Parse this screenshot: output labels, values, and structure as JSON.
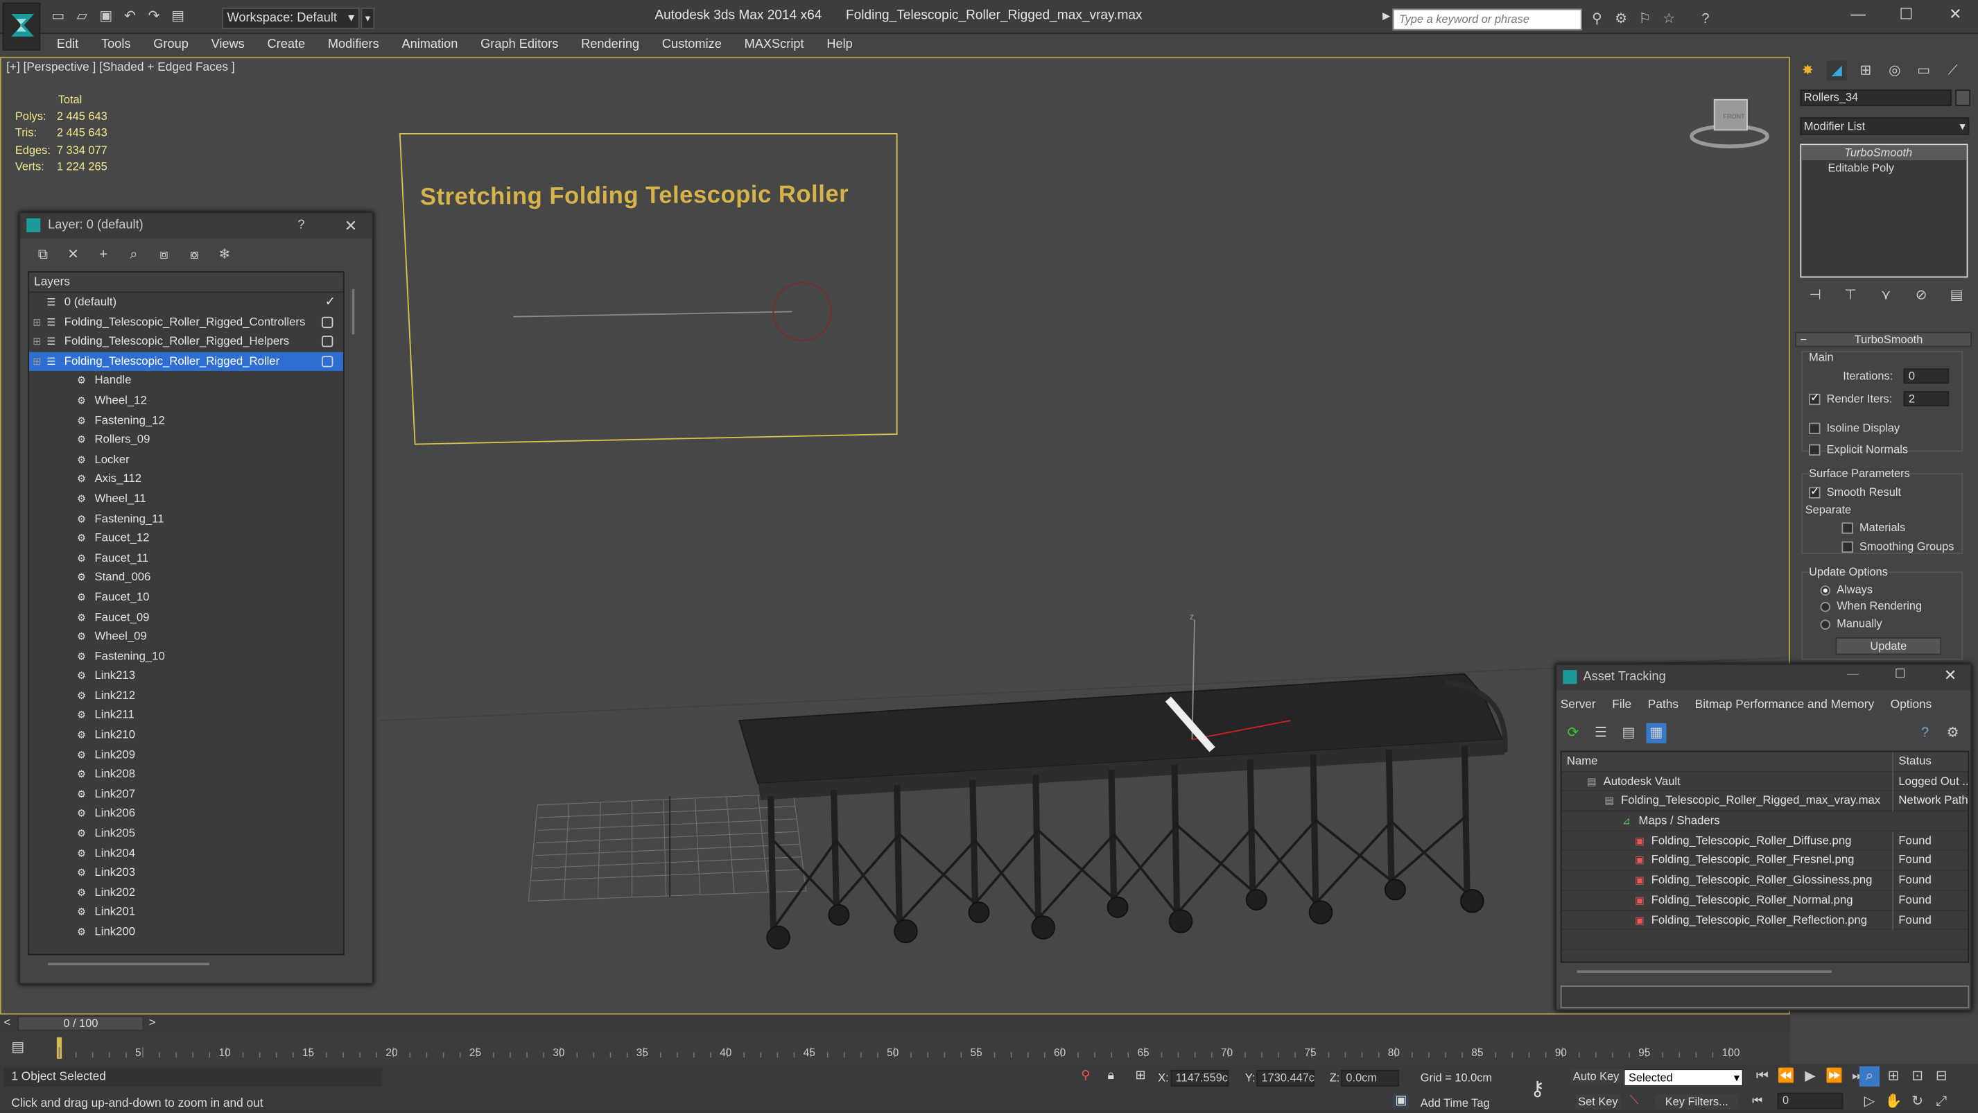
{
  "titlebar": {
    "app_title": "Autodesk 3ds Max  2014 x64",
    "file_name": "Folding_Telescopic_Roller_Rigged_max_vray.max",
    "workspace": "Workspace: Default",
    "search_placeholder": "Type a keyword or phrase"
  },
  "menu": [
    "Edit",
    "Tools",
    "Group",
    "Views",
    "Create",
    "Modifiers",
    "Animation",
    "Graph Editors",
    "Rendering",
    "Customize",
    "MAXScript",
    "Help"
  ],
  "viewport": {
    "label": "[+] [Perspective ] [Shaded + Edged Faces ]",
    "stats_header": "Total",
    "stats": [
      {
        "key": "Polys:",
        "value": "2 445 643"
      },
      {
        "key": "Tris:",
        "value": "2 445 643"
      },
      {
        "key": "Edges:",
        "value": "7 334 077"
      },
      {
        "key": "Verts:",
        "value": "1 224 265"
      }
    ],
    "banner_text": "Stretching Folding Telescopic Roller",
    "viewcube_label": "FRONT"
  },
  "layer_dialog": {
    "title": "Layer: 0 (default)",
    "help": "?",
    "column": "Layers",
    "layers": [
      {
        "name": "0 (default)",
        "level": 0,
        "checked": true
      },
      {
        "name": "Folding_Telescopic_Roller_Rigged_Controllers",
        "level": 0,
        "box": true
      },
      {
        "name": "Folding_Telescopic_Roller_Rigged_Helpers",
        "level": 0,
        "box": true
      },
      {
        "name": "Folding_Telescopic_Roller_Rigged_Roller",
        "level": 0,
        "box": true,
        "selected": true
      },
      {
        "name": "Handle",
        "level": 1
      },
      {
        "name": "Wheel_12",
        "level": 1
      },
      {
        "name": "Fastening_12",
        "level": 1
      },
      {
        "name": "Rollers_09",
        "level": 1
      },
      {
        "name": "Locker",
        "level": 1
      },
      {
        "name": "Axis_112",
        "level": 1
      },
      {
        "name": "Wheel_11",
        "level": 1
      },
      {
        "name": "Fastening_11",
        "level": 1
      },
      {
        "name": "Faucet_12",
        "level": 1
      },
      {
        "name": "Faucet_11",
        "level": 1
      },
      {
        "name": "Stand_006",
        "level": 1
      },
      {
        "name": "Faucet_10",
        "level": 1
      },
      {
        "name": "Faucet_09",
        "level": 1
      },
      {
        "name": "Wheel_09",
        "level": 1
      },
      {
        "name": "Fastening_10",
        "level": 1
      },
      {
        "name": "Link213",
        "level": 1
      },
      {
        "name": "Link212",
        "level": 1
      },
      {
        "name": "Link211",
        "level": 1
      },
      {
        "name": "Link210",
        "level": 1
      },
      {
        "name": "Link209",
        "level": 1
      },
      {
        "name": "Link208",
        "level": 1
      },
      {
        "name": "Link207",
        "level": 1
      },
      {
        "name": "Link206",
        "level": 1
      },
      {
        "name": "Link205",
        "level": 1
      },
      {
        "name": "Link204",
        "level": 1
      },
      {
        "name": "Link203",
        "level": 1
      },
      {
        "name": "Link202",
        "level": 1
      },
      {
        "name": "Link201",
        "level": 1
      },
      {
        "name": "Link200",
        "level": 1
      }
    ]
  },
  "command_panel": {
    "object_name": "Rollers_34",
    "modifier_list": "Modifier List",
    "stack": [
      "TurboSmooth",
      "Editable Poly"
    ],
    "rollout_title": "TurboSmooth",
    "main_group": "Main",
    "iterations_label": "Iterations:",
    "iterations_value": "0",
    "render_iters_label": "Render Iters:",
    "render_iters_value": "2",
    "isoline_label": "Isoline Display",
    "explicit_normals_label": "Explicit Normals",
    "surface_group": "Surface Parameters",
    "smooth_result_label": "Smooth Result",
    "separate_label": "Separate",
    "materials_label": "Materials",
    "smoothing_groups_label": "Smoothing Groups",
    "update_group": "Update Options",
    "always_label": "Always",
    "when_rendering_label": "When Rendering",
    "manually_label": "Manually",
    "update_button": "Update"
  },
  "asset_tracking": {
    "title": "Asset Tracking",
    "menu": [
      "Server",
      "File",
      "Paths",
      "Bitmap Performance and Memory",
      "Options"
    ],
    "col_name": "Name",
    "col_status": "Status",
    "rows": [
      {
        "name": "Autodesk Vault",
        "status": "Logged Out ...",
        "level": 1
      },
      {
        "name": "Folding_Telescopic_Roller_Rigged_max_vray.max",
        "status": "Network Path",
        "level": 2
      },
      {
        "name": "Maps / Shaders",
        "status": "",
        "level": 3
      },
      {
        "name": "Folding_Telescopic_Roller_Diffuse.png",
        "status": "Found",
        "level": 4
      },
      {
        "name": "Folding_Telescopic_Roller_Fresnel.png",
        "status": "Found",
        "level": 4
      },
      {
        "name": "Folding_Telescopic_Roller_Glossiness.png",
        "status": "Found",
        "level": 4
      },
      {
        "name": "Folding_Telescopic_Roller_Normal.png",
        "status": "Found",
        "level": 4
      },
      {
        "name": "Folding_Telescopic_Roller_Reflection.png",
        "status": "Found",
        "level": 4
      }
    ]
  },
  "timeline": {
    "frame_display": "0 / 100",
    "ticks": [
      "5",
      "10",
      "15",
      "20",
      "25",
      "30",
      "35",
      "40",
      "45",
      "50",
      "55",
      "60",
      "65",
      "70",
      "75",
      "80",
      "85",
      "90",
      "95",
      "100"
    ]
  },
  "status": {
    "selection": "1 Object Selected",
    "prompt": "Click and drag up-and-down to zoom in and out",
    "x_label": "X:",
    "x_value": "1147.559c",
    "y_label": "Y:",
    "y_value": "1730.447c",
    "z_label": "Z:",
    "z_value": "0.0cm",
    "grid": "Grid = 10.0cm",
    "auto_key": "Auto Key",
    "set_key": "Set Key",
    "selected_dropdown": "Selected",
    "key_filters": "Key Filters...",
    "add_time_tag": "Add Time Tag",
    "frame_value": "0"
  },
  "colors": {
    "selection_blue": "#2e6ed1",
    "viewport_border": "#b5a24a",
    "stat_text": "#f0e68c",
    "banner_text": "#d7b44a"
  }
}
